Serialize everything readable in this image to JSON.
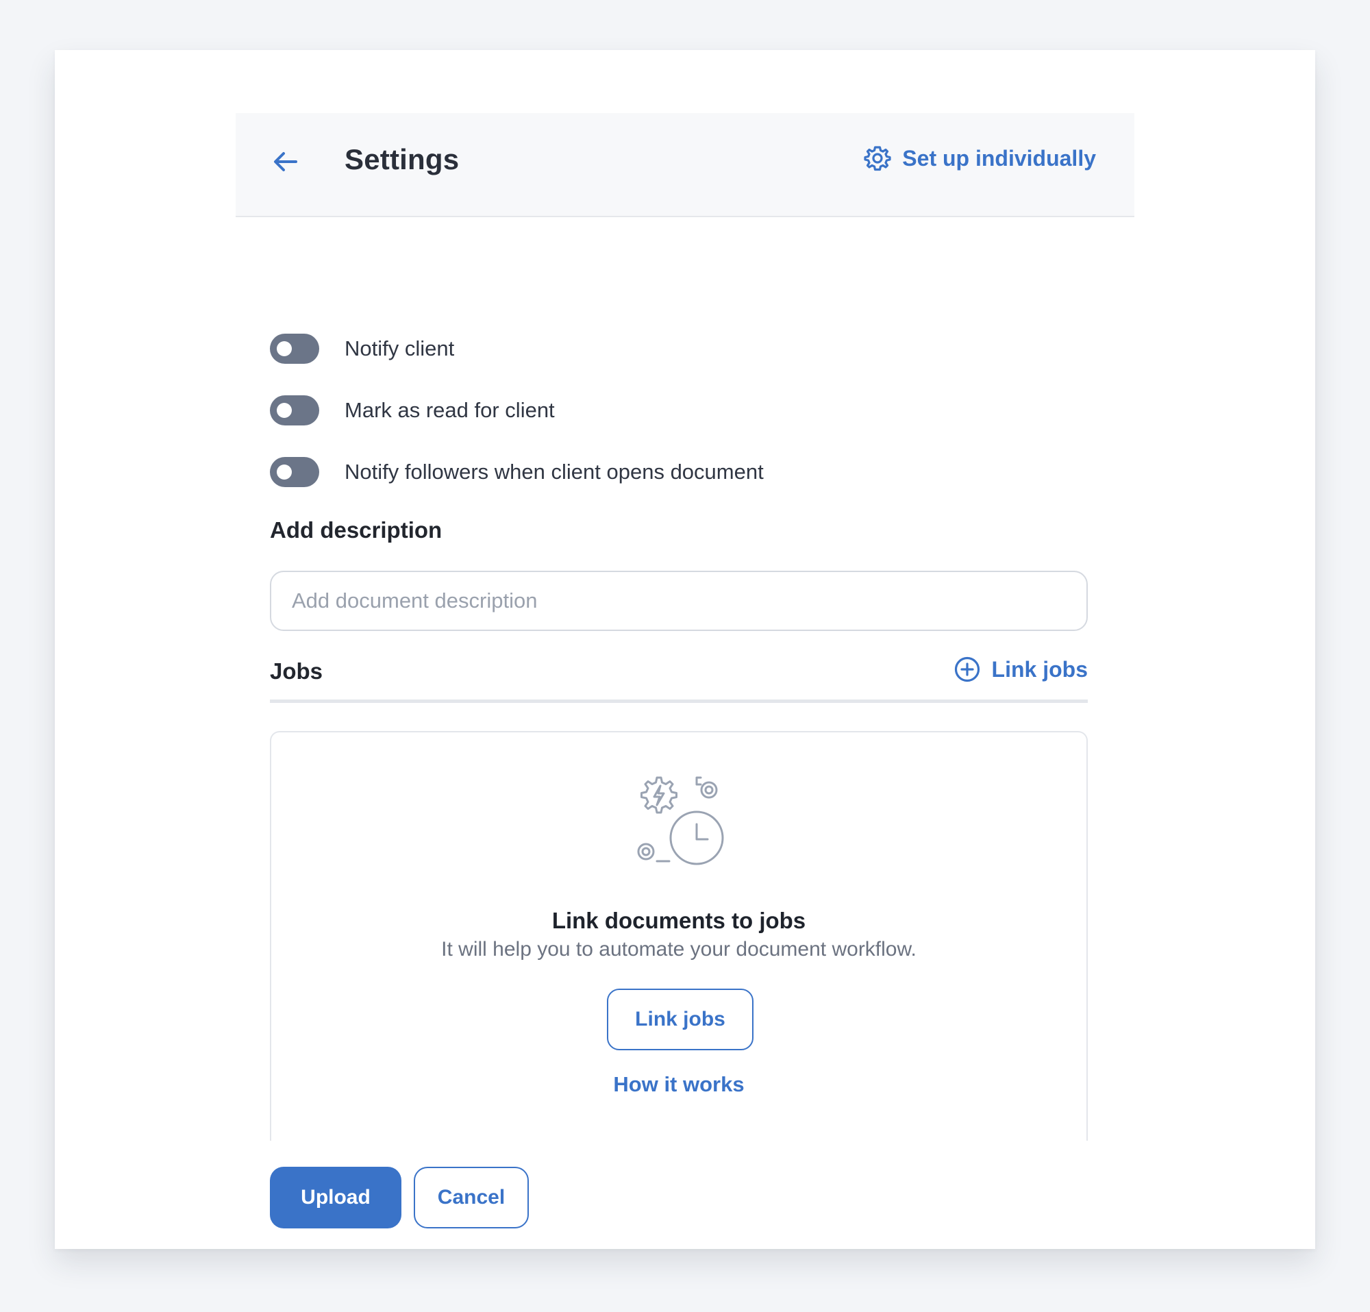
{
  "header": {
    "title": "Settings",
    "setup_link": "Set up individually",
    "icons": {
      "back": "arrow-left-icon",
      "setup": "gear-icon"
    }
  },
  "toggles": [
    {
      "label": "Notify client",
      "on": false
    },
    {
      "label": "Mark as read for client",
      "on": false
    },
    {
      "label": "Notify followers when client opens document",
      "on": false
    }
  ],
  "description": {
    "label": "Add description",
    "placeholder": "Add document description",
    "value": ""
  },
  "jobs": {
    "label": "Jobs",
    "link_label": "Link jobs",
    "link_icon": "plus-circle-icon",
    "empty": {
      "illustration": "automation-gears-clock-icon",
      "title": "Link documents to jobs",
      "subtitle": "It will help you to automate your document workflow.",
      "button_label": "Link jobs",
      "help_link": "How it works"
    }
  },
  "footer": {
    "upload_label": "Upload",
    "cancel_label": "Cancel"
  },
  "colors": {
    "accent": "#3a73c8",
    "toggle_off": "#6b7588",
    "page_bg": "#f3f5f8",
    "header_bg": "#f7f8fa"
  }
}
